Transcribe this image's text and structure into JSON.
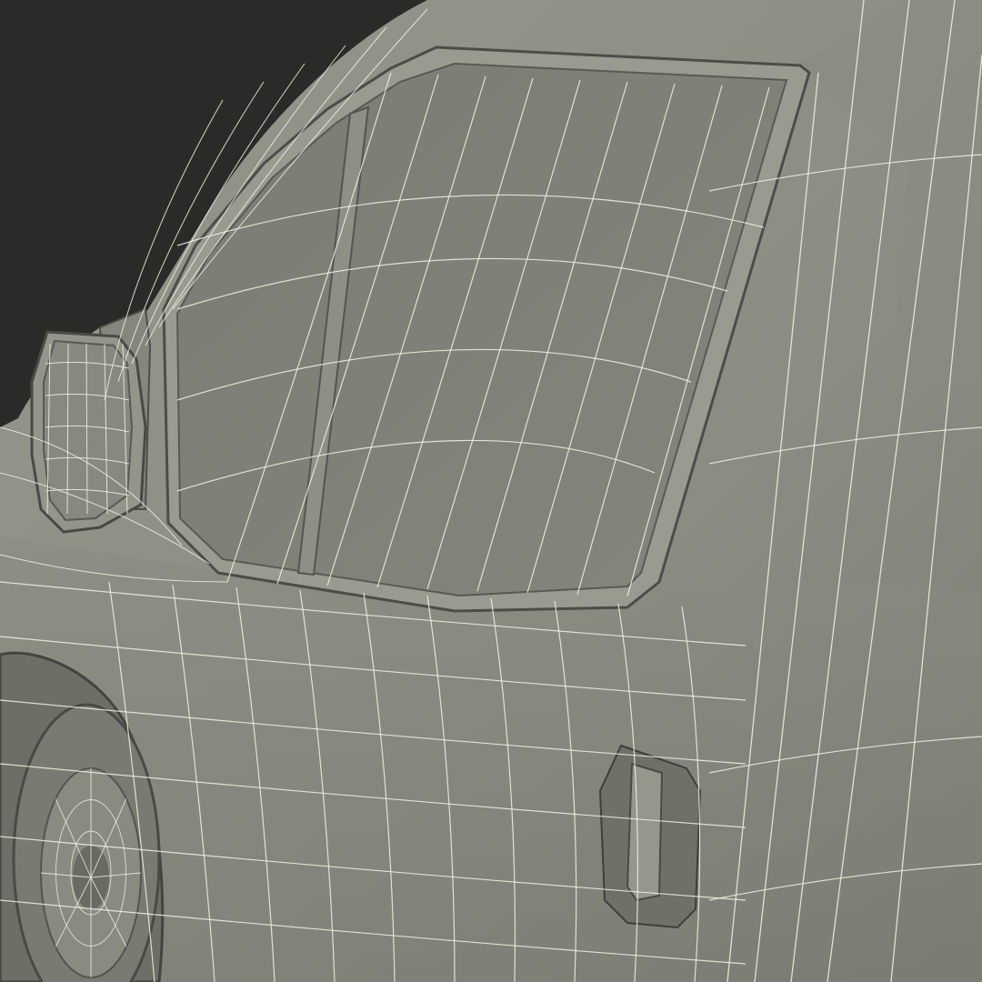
{
  "scene": {
    "subject": "wireframe-car-model",
    "view": "front-left-close-up",
    "colors": {
      "background": "#2b2a28",
      "body": "#8e8e84",
      "body_shadow": "#7c7c73",
      "glass": "#7f7f76",
      "wire": "#f2f1e4",
      "seam": "#4a4a44"
    }
  }
}
